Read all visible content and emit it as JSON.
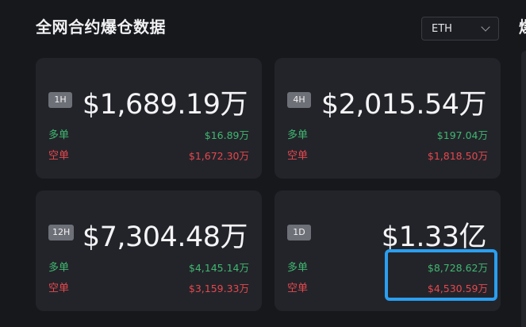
{
  "header": {
    "title": "全网合约爆仓数据",
    "partial_title": "爆",
    "coin_select": {
      "value": "ETH"
    }
  },
  "colors": {
    "long": "#3fb871",
    "short": "#e5484d",
    "highlight": "#2a9ff0"
  },
  "cards": [
    {
      "period": "1H",
      "total": "$1,689.19万",
      "long_label": "多单",
      "long_value": "$16.89万",
      "short_label": "空单",
      "short_value": "$1,672.30万"
    },
    {
      "period": "4H",
      "total": "$2,015.54万",
      "long_label": "多单",
      "long_value": "$197.04万",
      "short_label": "空单",
      "short_value": "$1,818.50万"
    },
    {
      "period": "12H",
      "total": "$7,304.48万",
      "long_label": "多单",
      "long_value": "$4,145.14万",
      "short_label": "空单",
      "short_value": "$3,159.33万"
    },
    {
      "period": "1D",
      "total": "$1.33亿",
      "long_label": "多单",
      "long_value": "$8,728.62万",
      "short_label": "空单",
      "short_value": "$4,530.59万"
    }
  ]
}
